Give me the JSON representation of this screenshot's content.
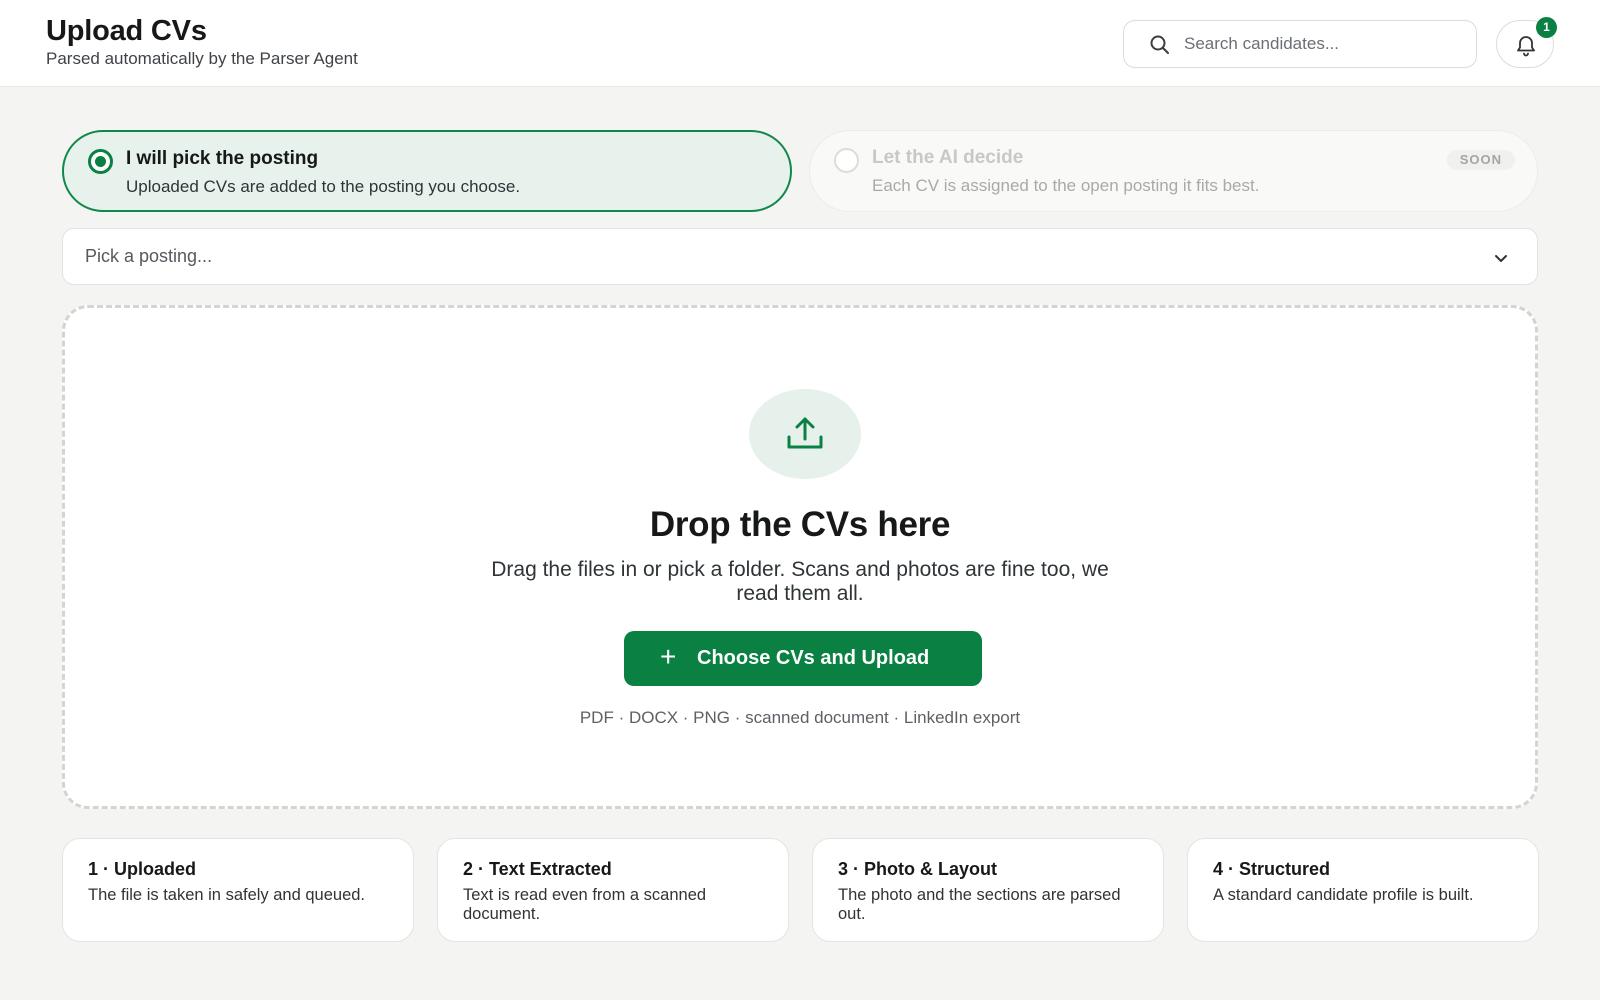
{
  "header": {
    "title": "Upload CVs",
    "subtitle": "Parsed automatically by the Parser Agent",
    "search_placeholder": "Search candidates...",
    "notification_count": "1"
  },
  "assignment": {
    "manual": {
      "title": "I will pick the posting",
      "description": "Uploaded CVs are added to the posting you choose.",
      "selected": true
    },
    "ai": {
      "title": "Let the AI decide",
      "description": "Each CV is assigned to the open posting it fits best.",
      "badge": "SOON",
      "selected": false
    }
  },
  "posting_select": {
    "placeholder": "Pick a posting..."
  },
  "dropzone": {
    "heading": "Drop the CVs here",
    "description": "Drag the files in or pick a folder. Scans and photos are fine too, we read them all.",
    "button_plus": "+",
    "button_label": "Choose CVs and Upload",
    "formats": "PDF · DOCX · PNG · scanned document · LinkedIn export"
  },
  "steps": [
    {
      "title": "1 · Uploaded",
      "description": "The file is taken in safely and queued."
    },
    {
      "title": "2 · Text Extracted",
      "description": "Text is read even from a scanned document."
    },
    {
      "title": "3 · Photo & Layout",
      "description": "The photo and the sections are parsed out."
    },
    {
      "title": "4 · Structured",
      "description": "A standard candidate profile is built."
    }
  ],
  "colors": {
    "accent": "#0a8043",
    "accent_light": "#e7f2ec",
    "background": "#f4f4f2"
  },
  "icons": {
    "search": "search-icon",
    "notifications": "bell-icon",
    "select": "chevron-down-icon",
    "upload": "upload-icon"
  }
}
